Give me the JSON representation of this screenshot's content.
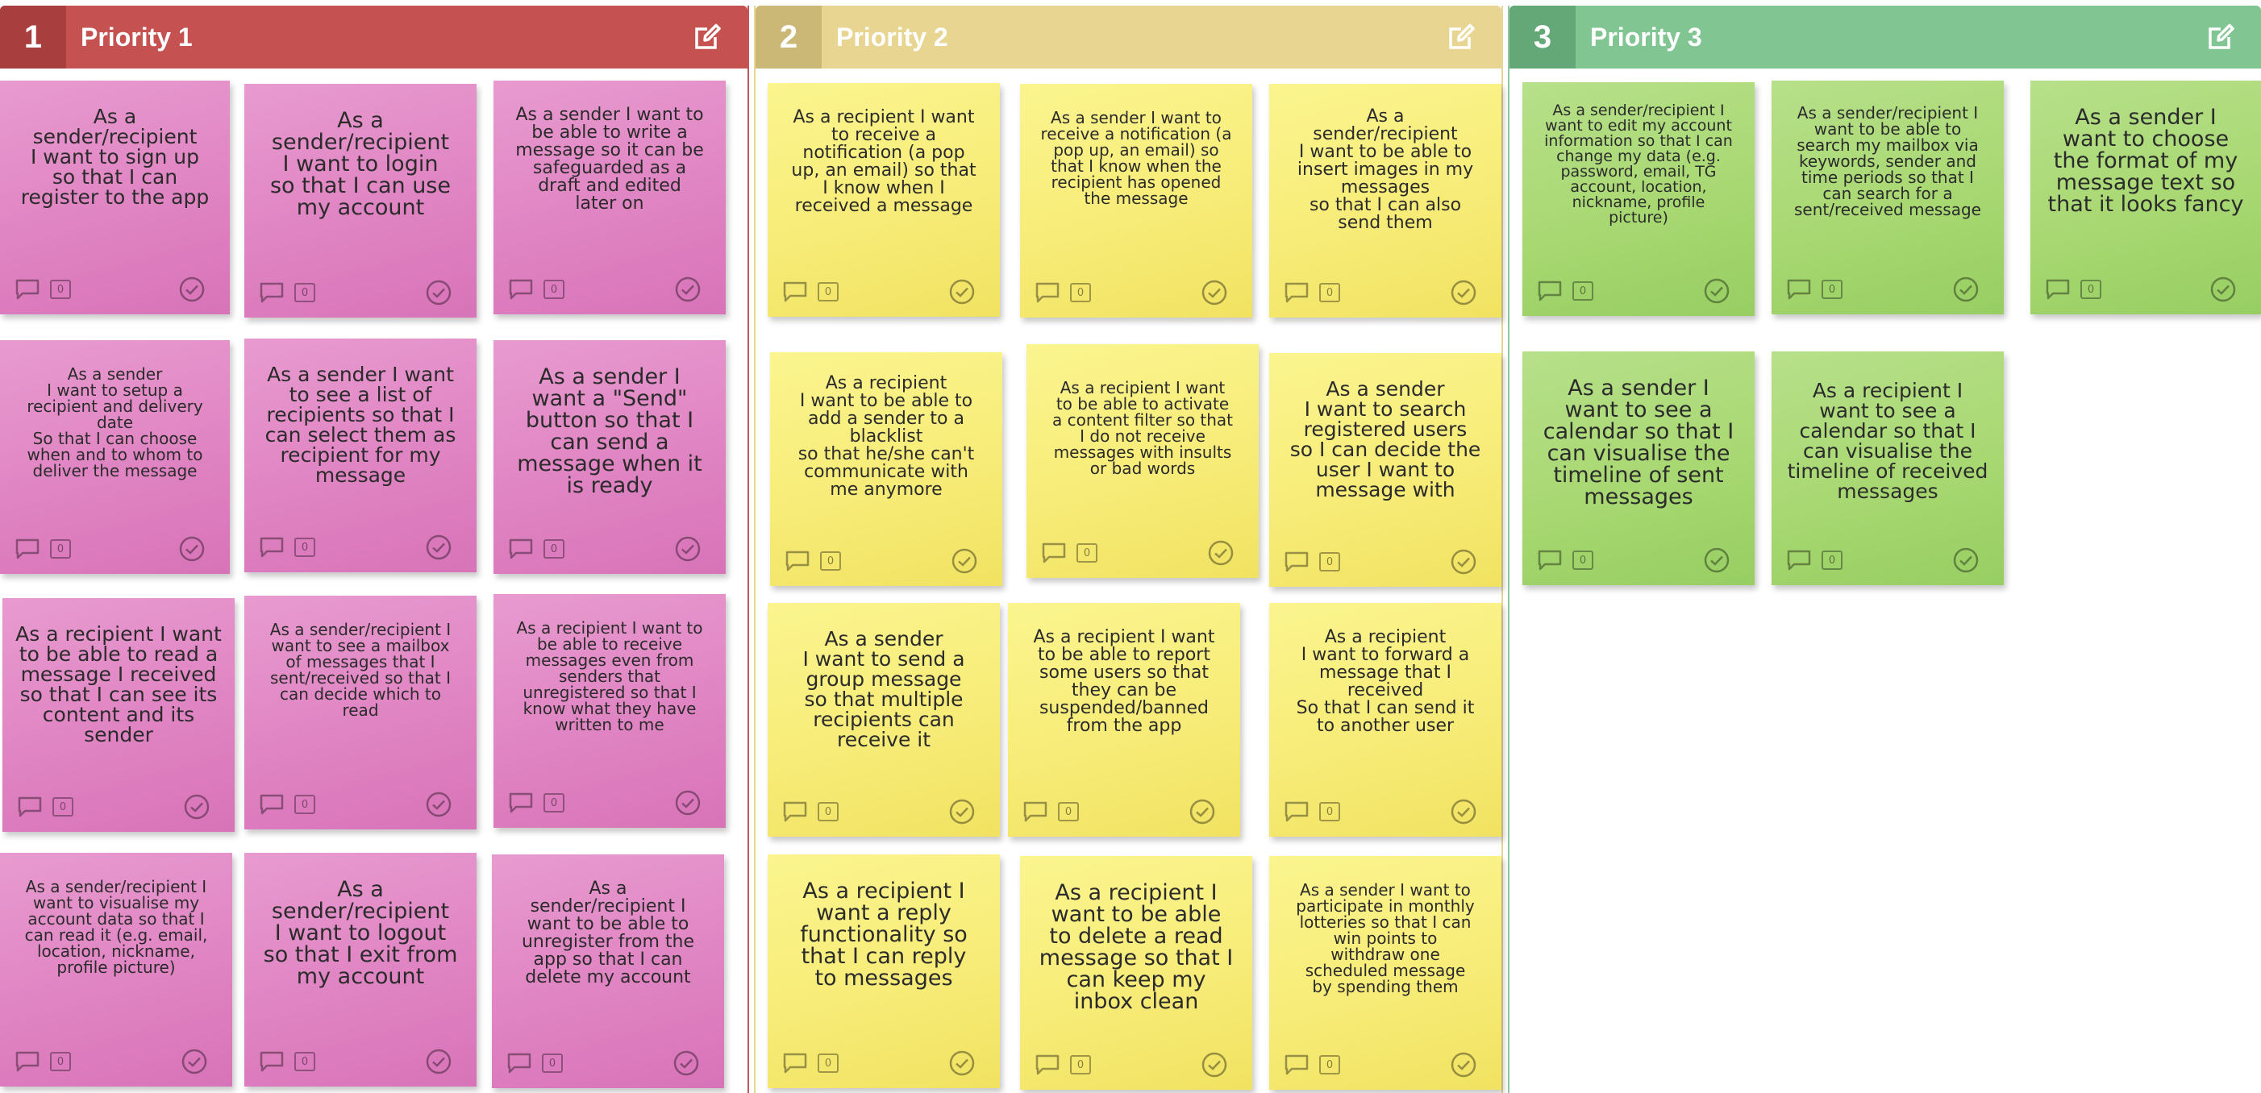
{
  "columns": [
    {
      "number": "1",
      "title": "Priority 1",
      "color": "#c55151",
      "notes": [
        {
          "text": "As a\nsender/recipient\nI want to sign up\nso that I can\nregister to the app",
          "comments": "0"
        },
        {
          "text": "As a\nsender/recipient\nI want to login\nso that I can use\nmy account",
          "comments": "0"
        },
        {
          "text": "As a sender I want to\nbe able to write a\nmessage so it can be\nsafeguarded as a\ndraft and edited\nlater on",
          "comments": "0"
        },
        {
          "text": "As a sender\nI want to setup a\nrecipient and delivery\ndate\nSo that I can choose\nwhen and to whom to\ndeliver the message",
          "comments": "0"
        },
        {
          "text": "As a sender I want\nto see a list of\nrecipients so that I\ncan select them as\nrecipient for my\nmessage",
          "comments": "0"
        },
        {
          "text": "As a sender I\nwant a \"Send\"\nbutton so that I\ncan send a\nmessage when it\nis ready",
          "comments": "0"
        },
        {
          "text": "As a recipient I want\nto be able to read a\nmessage I received\nso that I can see its\ncontent and its\nsender",
          "comments": "0"
        },
        {
          "text": "As a sender/recipient I\nwant to see a mailbox\nof messages that I\nsent/received so that I\ncan decide which to\nread",
          "comments": "0"
        },
        {
          "text": "As a recipient I want to\nbe able to receive\nmessages even from\nsenders that\nunregistered so that I\nknow what they have\nwritten to me",
          "comments": "0"
        },
        {
          "text": "As a sender/recipient I\nwant to visualise my\naccount data so that I\ncan read it (e.g. email,\nlocation, nickname,\nprofile picture)",
          "comments": "0"
        },
        {
          "text": "As a\nsender/recipient\nI want to logout\nso that I exit from\nmy account",
          "comments": "0"
        },
        {
          "text": "As a\nsender/recipient I\nwant to be able to\nunregister from the\napp so that I can\ndelete my account",
          "comments": "0"
        }
      ]
    },
    {
      "number": "2",
      "title": "Priority 2",
      "color": "#e7d591",
      "notes": [
        {
          "text": "As a recipient I want\nto receive a\nnotification (a pop\nup, an email) so that\nI know when I\nreceived a message",
          "comments": "0"
        },
        {
          "text": "As a sender I want to\nreceive a notification (a\npop up, an email) so\nthat I know when the\nrecipient has opened\nthe message",
          "comments": "0"
        },
        {
          "text": "As a\nsender/recipient\nI want to be able to\ninsert images in my\nmessages\nso that I can also\nsend them",
          "comments": "0"
        },
        {
          "text": "As a recipient\nI want to be able to\nadd a sender to a\nblacklist\nso that he/she can't\ncommunicate with\nme anymore",
          "comments": "0"
        },
        {
          "text": "As a recipient I want\nto be able to activate\na content filter so that\nI do not receive\nmessages with insults\nor bad words",
          "comments": "0"
        },
        {
          "text": "As a sender\nI want to search\nregistered users\nso I can decide the\nuser I want to\nmessage with",
          "comments": "0"
        },
        {
          "text": "As a sender\nI want to send a\ngroup message\nso that multiple\nrecipients can\nreceive it",
          "comments": "0"
        },
        {
          "text": "As a recipient I want\nto be able to report\nsome users so that\nthey can be\nsuspended/banned\nfrom the app",
          "comments": "0"
        },
        {
          "text": "As a recipient\nI want to forward a\nmessage that I\nreceived\nSo that I can send it\nto another user",
          "comments": "0"
        },
        {
          "text": "As a recipient I\nwant a reply\nfunctionality so\nthat I can reply\nto messages",
          "comments": "0"
        },
        {
          "text": "As a recipient I\nwant to be able\nto delete a read\nmessage so that I\ncan keep my\ninbox clean",
          "comments": "0"
        },
        {
          "text": "As a sender I want to\nparticipate in monthly\nlotteries so that I can\nwin points to\nwithdraw one\nscheduled message\nby spending them",
          "comments": "0"
        }
      ]
    },
    {
      "number": "3",
      "title": "Priority 3",
      "color": "#80c592",
      "notes": [
        {
          "text": "As a sender/recipient I\nwant to edit my account\ninformation so that I can\nchange my data (e.g.\npassword, email, TG\naccount, location,\nnickname, profile\npicture)",
          "comments": "0"
        },
        {
          "text": "As a sender/recipient I\nwant to be able to\nsearch my mailbox via\nkeywords, sender and\ntime periods so that I\ncan search for a\nsent/received message",
          "comments": "0"
        },
        {
          "text": "As a sender I\nwant to choose\nthe format of my\nmessage text so\nthat it looks fancy",
          "comments": "0"
        },
        {
          "text": "As a sender I\nwant to see a\ncalendar so that I\ncan visualise the\ntimeline of sent\nmessages",
          "comments": "0"
        },
        {
          "text": "As a recipient I\nwant to see a\ncalendar so that I\ncan visualise the\ntimeline of received\nmessages",
          "comments": "0"
        }
      ]
    }
  ]
}
